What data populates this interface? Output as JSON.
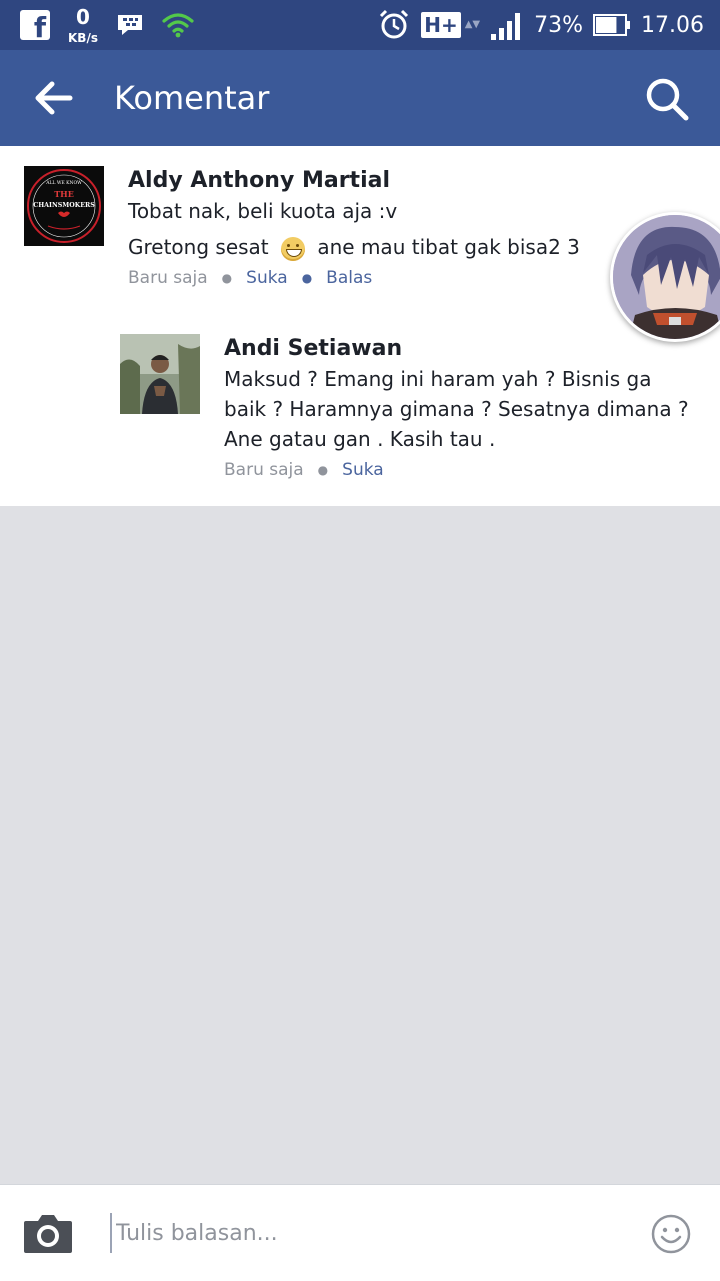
{
  "status_bar": {
    "net_speed_value": "0",
    "net_speed_unit": "KB/s",
    "network_type": "H+",
    "battery_percent": "73%",
    "battery_level": 0.73,
    "time": "17.06"
  },
  "app_bar": {
    "title": "Komentar"
  },
  "comments": [
    {
      "author": "Aldy Anthony Martial",
      "avatar_text": {
        "top": "ALL WE KNOW",
        "the": "THE",
        "brand": "CHAINSMOKERS"
      },
      "line1": "Tobat nak, beli kuota aja :v",
      "line2_before": "Gretong  sesat",
      "line2_after": "ane mau tibat gak bisa2 3",
      "time": "Baru saja",
      "like_label": "Suka",
      "reply_label": "Balas"
    },
    {
      "author": "Andi Setiawan",
      "lines": [
        "Maksud ? Emang ini haram yah ? Bisnis ga",
        "baik ? Haramnya gimana ? Sesatnya dimana ?",
        "Ane gatau gan . Kasih tau ."
      ],
      "time": "Baru saja",
      "like_label": "Suka"
    }
  ],
  "composer": {
    "placeholder": "Tulis balasan..."
  },
  "colors": {
    "status_bar": "#2f4680",
    "app_bar": "#3b5998",
    "link": "#4b659e",
    "meta": "#90949c",
    "page_bg": "#dfe0e4"
  },
  "icons": [
    "facebook-icon",
    "bbm-icon",
    "wifi-icon",
    "alarm-icon",
    "signal-icon",
    "battery-icon",
    "back-arrow-icon",
    "search-icon",
    "camera-icon",
    "smiley-icon"
  ]
}
